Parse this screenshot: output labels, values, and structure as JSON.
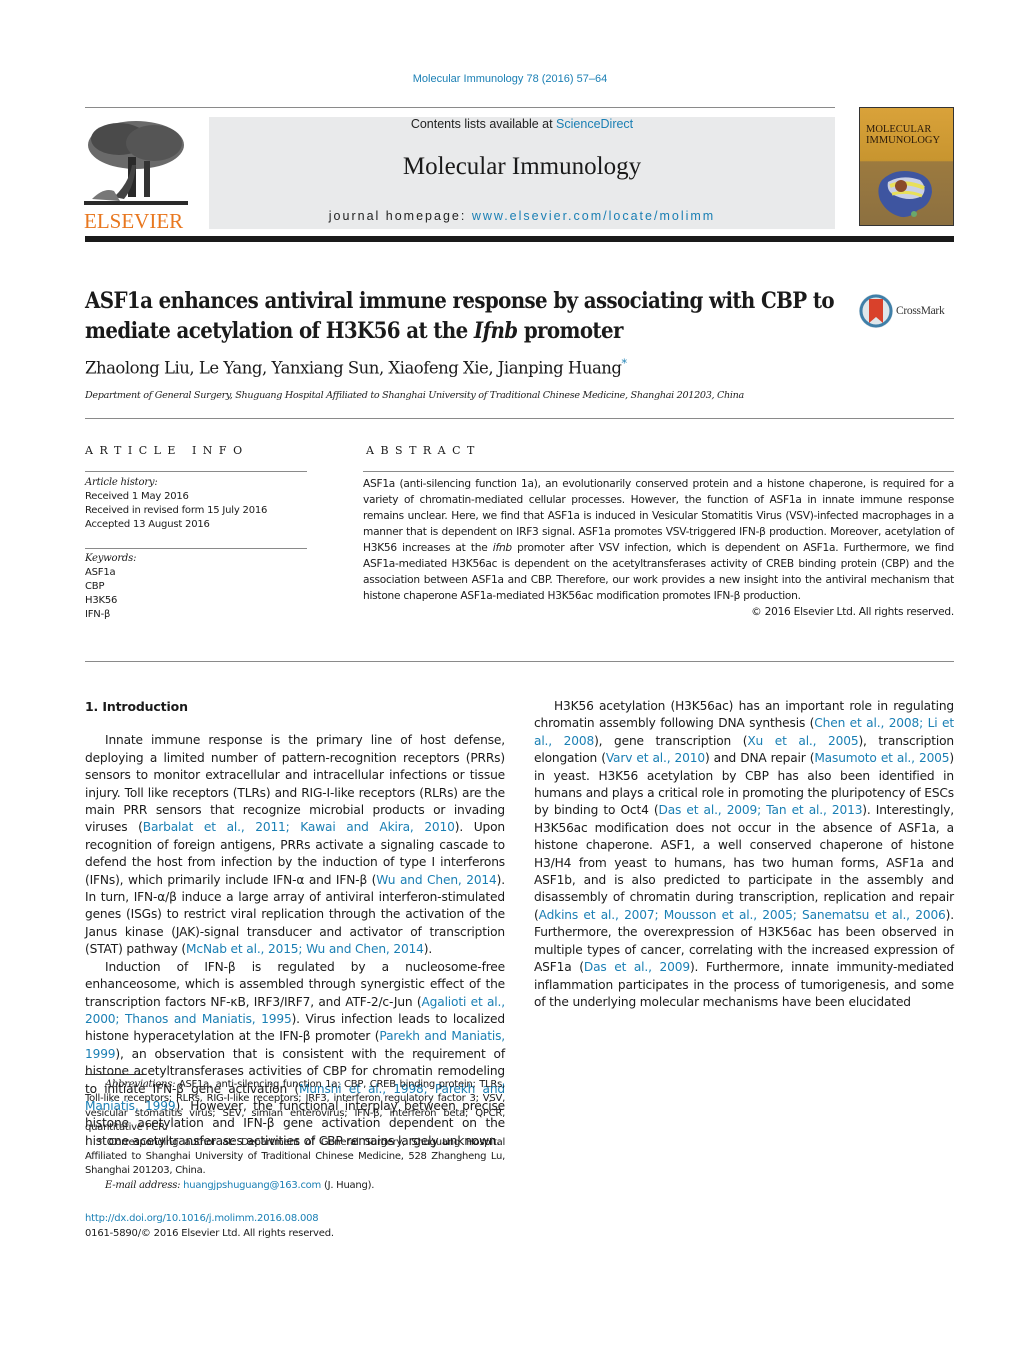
{
  "header": {
    "journal_ref": "Molecular Immunology 78 (2016) 57–64",
    "contents_prefix": "Contents lists available at ",
    "contents_link": "ScienceDirect",
    "journal_title": "Molecular Immunology",
    "homepage_prefix": "journal homepage: ",
    "homepage_link": "www.elsevier.com/locate/molimm",
    "publisher_logo": "ELSEVIER",
    "cover_title_line1": "MOLECULAR",
    "cover_title_line2": "IMMUNOLOGY"
  },
  "article": {
    "title_part1": "ASF1a enhances antiviral immune response by associating with CBP to mediate acetylation of H3K56 at the ",
    "title_italic": "Ifnb",
    "title_part2": " promoter",
    "crossmark_label": "CrossMark",
    "authors": "Zhaolong Liu, Le Yang, Yanxiang Sun, Xiaofeng Xie, Jianping Huang",
    "corresponding_mark": "*",
    "affiliation": "Department of General Surgery, Shuguang Hospital Affiliated to Shanghai University of Traditional Chinese Medicine, Shanghai 201203, China"
  },
  "article_info": {
    "heading": "ARTICLE INFO",
    "history_label": "Article history:",
    "history": [
      "Received 1 May 2016",
      "Received in revised form 15 July 2016",
      "Accepted 13 August 2016"
    ],
    "keywords_label": "Keywords:",
    "keywords": [
      "ASF1a",
      "CBP",
      "H3K56",
      "IFN-β"
    ]
  },
  "abstract": {
    "heading": "ABSTRACT",
    "text_1": "ASF1a (anti-silencing function 1a), an evolutionarily conserved protein and a histone chaperone, is required for a variety of chromatin-mediated cellular processes. However, the function of ASF1a in innate immune response remains unclear. Here, we find that ASF1a is induced in Vesicular Stomatitis Virus (VSV)-infected macrophages in a manner that is dependent on IRF3 signal. ASF1a promotes VSV-triggered IFN-β production. Moreover, acetylation of H3K56 increases at the ",
    "text_italic": "ifnb",
    "text_2": " promoter after VSV infection, which is dependent on ASF1a. Furthermore, we find ASF1a-mediated H3K56ac is dependent on the acetyltransferases activity of CREB binding protein (CBP) and the association between ASF1a and CBP. Therefore, our work provides a new insight into the antiviral mechanism that histone chaperone ASF1a-mediated H3K56ac modification promotes IFN-β production.",
    "copyright": "© 2016 Elsevier Ltd. All rights reserved."
  },
  "intro": {
    "heading": "1.  Introduction",
    "p1_a": "Innate immune response is the primary line of host defense, deploying a limited number of pattern-recognition receptors (PRRs) sensors to monitor extracellular and intracellular infections or tissue injury. Toll like receptors (TLRs) and RIG-I-like receptors (RLRs) are the main PRR sensors that recognize microbial products or invading viruses (",
    "p1_ref1": "Barbalat et al., 2011; Kawai and Akira, 2010",
    "p1_b": "). Upon recognition of foreign antigens, PRRs activate a signaling cascade to defend the host from infection by the induction of type I interferons (IFNs), which primarily include IFN-α and IFN-β (",
    "p1_ref2": "Wu and Chen, 2014",
    "p1_c": "). In turn, IFN-α/β induce a large array of antiviral interferon-stimulated genes (ISGs) to restrict viral replication through the activation of the Janus kinase (JAK)-signal transducer and activator of transcription (STAT) pathway (",
    "p1_ref3": "McNab et al., 2015; Wu and Chen, 2014",
    "p1_d": ").",
    "p2_a": "Induction of IFN-β is regulated by a nucleosome-free enhanceosome, which is assembled through synergistic effect of the transcription factors NF-κB, IRF3/IRF7, and ATF-2/c-Jun (",
    "p2_ref1": "Agalioti et al., 2000; Thanos and Maniatis, 1995",
    "p2_b": "). Virus infection leads to localized histone hyperacetylation at the IFN-β promoter (",
    "p2_ref2": "Parekh and Maniatis, 1999",
    "p2_c": "), an observation that is consistent with the requirement of histone acetyltransferases activities of CBP for chromatin remodeling to initiate IFN-β gene activation (",
    "p2_ref3": "Munshi et al., 1998; Parekh and Maniatis, 1999",
    "p2_d": "). However, the functional interplay between precise histone acetylation and IFN-β gene activation dependent on the histone acetyltransferases activities of CBP remains largely unknown.",
    "p3_a": "H3K56 acetylation (H3K56ac) has an important role in regulating chromatin assembly following DNA synthesis (",
    "p3_ref1": "Chen et al., 2008; Li et al., 2008",
    "p3_b": "), gene transcription (",
    "p3_ref2": "Xu et al., 2005",
    "p3_c": "), transcription elongation (",
    "p3_ref3": "Varv et al., 2010",
    "p3_d": ") and DNA repair (",
    "p3_ref4": "Masumoto et al., 2005",
    "p3_e": ") in yeast. H3K56 acetylation by CBP has also been identified in humans and plays a critical role in promoting the pluripotency of ESCs by binding to Oct4 (",
    "p3_ref5": "Das et al., 2009; Tan et al., 2013",
    "p3_f": "). Interestingly, H3K56ac modification does not occur in the absence of ASF1a, a histone chaperone. ASF1, a well conserved chaperone of histone H3/H4 from yeast to humans, has two human forms, ASF1a and ASF1b, and is also predicted to participate in the assembly and disassembly of chromatin during transcription, replication and repair (",
    "p3_ref6": "Adkins et al., 2007; Mousson et al., 2005; Sanematsu et al., 2006",
    "p3_g": "). Furthermore, the overexpression of H3K56ac has been observed in multiple types of cancer, correlating with the increased expression of ASF1a (",
    "p3_ref7": "Das et al., 2009",
    "p3_h": "). Furthermore, innate immunity-mediated inflammation participates in the process of tumorigenesis, and some of the underlying molecular mechanisms have been elucidated"
  },
  "footnotes": {
    "abbrev_label": "Abbreviations:",
    "abbrev_text": " ASF1a, anti-silencing function 1a; CBP, CREB binding protein; TLRs, Toll-like receptors; RLRs, RIG-I-like receptors; IRF3, interferon regulatory factor 3; VSV, vesicular stomatitis virus; SEV, simian enterovirus; IFN-β, interferon beta; QPCR, quantitative PCR.",
    "corr_mark": "*",
    "corr_text": " Corresponding author at: Department of General Surgery, Shuguang Hospital Affiliated to Shanghai University of Traditional Chinese Medicine, 528 Zhangheng Lu, Shanghai 201203, China.",
    "email_label": "E-mail address:",
    "email": "huangjpshuguang@163.com",
    "email_suffix": " (J. Huang).",
    "doi": "http://dx.doi.org/10.1016/j.molimm.2016.08.008",
    "issn_line": "0161-5890/© 2016 Elsevier Ltd. All rights reserved."
  },
  "colors": {
    "link": "#1a7fb4",
    "elsevier_orange": "#e8771f",
    "banner_gray": "#e9eaeb",
    "crossmark_red": "#d9412b"
  }
}
